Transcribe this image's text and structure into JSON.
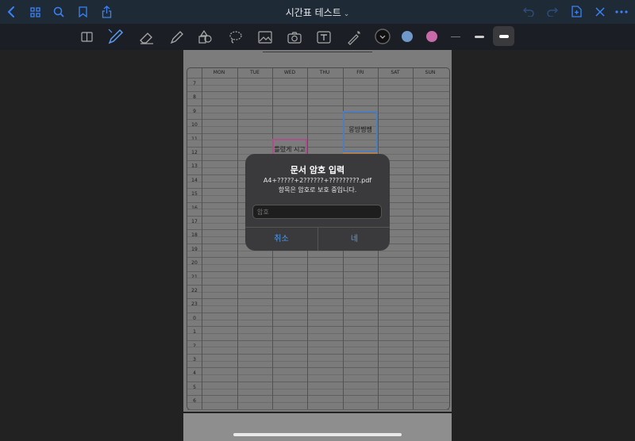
{
  "header": {
    "title": "시간표 테스트",
    "dropdown_glyph": "⌄"
  },
  "toolbar": {
    "colors": {
      "blue": "#6f97c9",
      "pink": "#c96aa8",
      "active_bg": "#3a3a3c"
    }
  },
  "timetable": {
    "days": [
      "MON",
      "TUE",
      "WED",
      "THU",
      "FRI",
      "SAT",
      "SUN"
    ],
    "hours": [
      "7",
      "8",
      "9",
      "10",
      "11",
      "12",
      "13",
      "14",
      "15",
      "16",
      "17",
      "18",
      "19",
      "20",
      "21",
      "22",
      "23",
      "0",
      "1",
      "2",
      "3",
      "4",
      "5",
      "6"
    ],
    "events": [
      {
        "text": "틀렸게 시고",
        "color": "#c45aa0"
      },
      {
        "text": "몽땅쨍쨍",
        "color": "#5b8fd6"
      },
      {
        "text": "",
        "color": "#7ab24a"
      },
      {
        "text": "",
        "color": "#c9915a"
      }
    ]
  },
  "dialog": {
    "title": "문서 암호 입력",
    "filename": "A4+?????+2??????+?????????.pdf",
    "message": "항목은 암호로 보호 중입니다.",
    "password_placeholder": "암호",
    "password_value": "",
    "cancel_label": "취소",
    "confirm_label": "네"
  }
}
